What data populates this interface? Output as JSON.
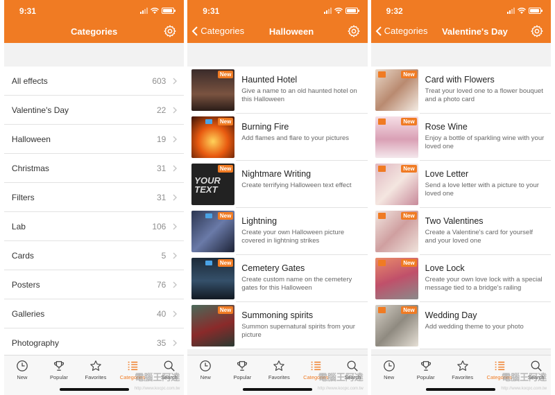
{
  "colors": {
    "accent": "#f07b23",
    "background": "#f2f2f2"
  },
  "screens": [
    {
      "time": "9:31",
      "title": "Categories",
      "settings_icon": "gear-icon",
      "categories": [
        {
          "label": "All effects",
          "count": "603"
        },
        {
          "label": "Valentine's Day",
          "count": "22"
        },
        {
          "label": "Halloween",
          "count": "19"
        },
        {
          "label": "Christmas",
          "count": "31"
        },
        {
          "label": "Filters",
          "count": "31"
        },
        {
          "label": "Lab",
          "count": "106"
        },
        {
          "label": "Cards",
          "count": "5"
        },
        {
          "label": "Posters",
          "count": "76"
        },
        {
          "label": "Galleries",
          "count": "40"
        },
        {
          "label": "Photography",
          "count": "35"
        }
      ]
    },
    {
      "time": "9:31",
      "back_label": "Categories",
      "title": "Halloween",
      "effects": [
        {
          "title": "Haunted Hotel",
          "desc": "Give a name to an old haunted hotel on this Halloween",
          "badge": "New",
          "hd": false,
          "video": false
        },
        {
          "title": "Burning Fire",
          "desc": "Add flames and flare to your pictures",
          "badge": "New",
          "hd": false,
          "video": true
        },
        {
          "title": "Nightmare Writing",
          "desc": "Create terrifying Halloween text effect",
          "badge": "New",
          "hd": false,
          "video": false,
          "thumb_text": "YOUR TEXT"
        },
        {
          "title": "Lightning",
          "desc": "Create your own Halloween picture covered in lightning strikes",
          "badge": "New",
          "hd": false,
          "video": true
        },
        {
          "title": "Cemetery Gates",
          "desc": "Create custom name on the cemetery gates for this Halloween",
          "badge": "New",
          "hd": false,
          "video": true
        },
        {
          "title": "Summoning spirits",
          "desc": "Summon supernatural spirits from your picture",
          "badge": "New",
          "hd": false,
          "video": false
        }
      ]
    },
    {
      "time": "9:32",
      "back_label": "Categories",
      "title": "Valentine's Day",
      "effects": [
        {
          "title": "Card with Flowers",
          "desc": "Treat your loved one to a flower bouquet and a photo card",
          "badge": "New",
          "hd": true,
          "video": false
        },
        {
          "title": "Rose Wine",
          "desc": "Enjoy a bottle of sparkling wine with your loved one",
          "badge": "New",
          "hd": true,
          "video": false
        },
        {
          "title": "Love Letter",
          "desc": "Send a love letter with a picture to your loved one",
          "badge": "New",
          "hd": true,
          "video": false
        },
        {
          "title": "Two Valentines",
          "desc": "Create a Valentine's card for yourself and your loved one",
          "badge": "New",
          "hd": true,
          "video": false
        },
        {
          "title": "Love Lock",
          "desc": "Create your own love lock with a special message tied to a bridge's railing",
          "badge": "New",
          "hd": true,
          "video": false
        },
        {
          "title": "Wedding Day",
          "desc": "Add wedding theme to your photo",
          "badge": "New",
          "hd": true,
          "video": false
        }
      ]
    }
  ],
  "tabs": [
    {
      "label": "New",
      "icon": "clock-icon"
    },
    {
      "label": "Popular",
      "icon": "trophy-icon"
    },
    {
      "label": "Favorites",
      "icon": "star-icon"
    },
    {
      "label": "Categories",
      "icon": "list-icon"
    },
    {
      "label": "Search",
      "icon": "search-icon"
    }
  ],
  "watermark": {
    "text": "電腦王阿達",
    "url": "http://www.kocpc.com.tw"
  }
}
